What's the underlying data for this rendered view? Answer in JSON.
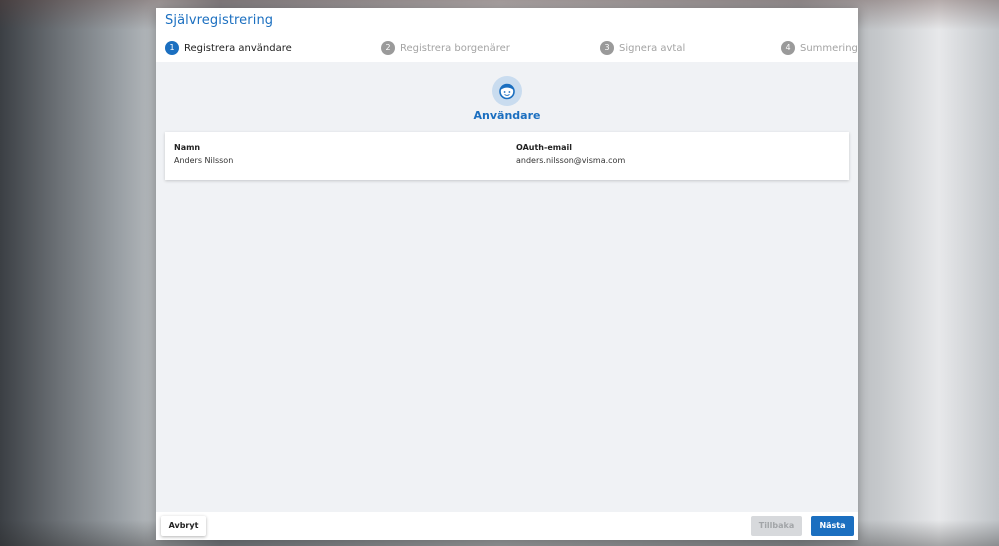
{
  "dialog": {
    "title": "Självregistrering"
  },
  "steps": [
    {
      "number": "1",
      "label": "Registrera användare",
      "active": true
    },
    {
      "number": "2",
      "label": "Registrera borgenärer",
      "active": false
    },
    {
      "number": "3",
      "label": "Signera avtal",
      "active": false
    },
    {
      "number": "4",
      "label": "Summering",
      "active": false
    }
  ],
  "section": {
    "icon": "user-face-icon",
    "title": "Användare"
  },
  "user_card": {
    "name_label": "Namn",
    "name_value": "Anders Nilsson",
    "email_label": "OAuth-email",
    "email_value": "anders.nilsson@visma.com"
  },
  "footer": {
    "cancel_label": "Avbryt",
    "back_label": "Tillbaka",
    "next_label": "Nästa"
  },
  "colors": {
    "accent": "#1b6fc0",
    "inactive_step": "#9a9a9a",
    "disabled_button": "#d7d9dc"
  }
}
